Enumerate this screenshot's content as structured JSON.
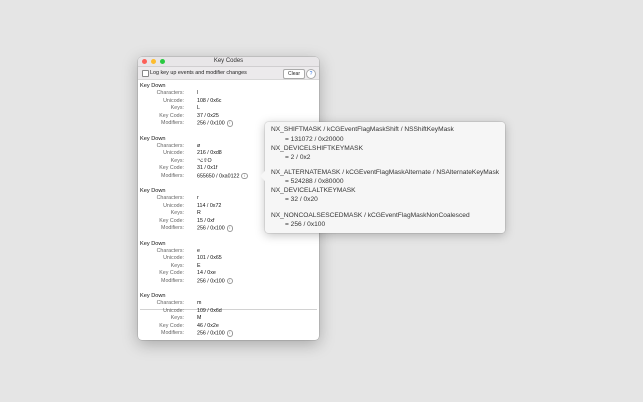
{
  "window": {
    "title": "Key Codes",
    "checkbox_label": "Log key up events and modifier changes",
    "clear_label": "Clear",
    "help_label": "?"
  },
  "labels": {
    "characters": "Characters:",
    "unicode": "Unicode:",
    "keys": "Keys:",
    "key_code": "Key Code:",
    "modifiers": "Modifiers:"
  },
  "events": [
    {
      "title": "Key Down",
      "characters": "l",
      "unicode": "108 / 0x6c",
      "keys": "L",
      "key_code": "37 / 0x25",
      "modifiers": "256 / 0x100"
    },
    {
      "title": "Key Down",
      "characters": "ø",
      "unicode": "216 / 0xd8",
      "keys": "⌥⇧O",
      "key_code": "31 / 0x1f",
      "modifiers": "655650 / 0xa0122"
    },
    {
      "title": "Key Down",
      "characters": "r",
      "unicode": "114 / 0x72",
      "keys": "R",
      "key_code": "15 / 0xf",
      "modifiers": "256 / 0x100"
    },
    {
      "title": "Key Down",
      "characters": "e",
      "unicode": "101 / 0x65",
      "keys": "E",
      "key_code": "14 / 0xe",
      "modifiers": "256 / 0x100"
    },
    {
      "title": "Key Down",
      "characters": "m",
      "unicode": "109 / 0x6d",
      "keys": "M",
      "key_code": "46 / 0x2e",
      "modifiers": "256 / 0x100"
    }
  ],
  "popover": [
    {
      "name": "NX_SHIFTMASK / kCGEventFlagMaskShift / NSShiftKeyMask",
      "value": "= 131072 / 0x20000"
    },
    {
      "name": "NX_DEVICELSHIFTKEYMASK",
      "value": "= 2 / 0x2"
    },
    {
      "name": "NX_ALTERNATEMASK / kCGEventFlagMaskAlternate / NSAlternateKeyMask",
      "value": "= 524288 / 0x80000"
    },
    {
      "name": "NX_DEVICELALTKEYMASK",
      "value": "= 32 / 0x20"
    },
    {
      "name": "NX_NONCOALSESCEDMASK / kCGEventFlagMaskNonCoalesced",
      "value": "= 256 / 0x100"
    }
  ],
  "colors": {
    "close": "#fc5f57",
    "minimize": "#fdbc2e",
    "zoom": "#29c940",
    "background": "#e5e5e5"
  }
}
